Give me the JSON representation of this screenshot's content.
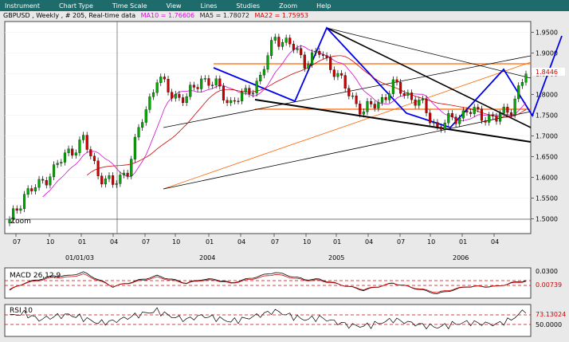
{
  "menu": {
    "items": [
      "Instrument",
      "Chart Type",
      "Time Scale",
      "View",
      "Lines",
      "Studies",
      "Zoom",
      "Help"
    ]
  },
  "info": {
    "symbol": "GBPUSD , Weekly , # 205, Real-time data",
    "ma10": "MA10 = 1.76606",
    "ma5": "MA5 = 1.78072",
    "ma22": "MA22 = 1.75953"
  },
  "price_panel": {
    "y_ticks": [
      "1.9500",
      "1.9000",
      "1.8500",
      "1.8000",
      "1.7500",
      "1.7000",
      "1.6500",
      "1.6000",
      "1.5500",
      "1.5000"
    ],
    "current_price": "1.8446",
    "zoom_marker": "Zoom"
  },
  "time_axis": {
    "labels": [
      "07",
      "10",
      "01",
      "04",
      "07",
      "10",
      "01",
      "04",
      "07",
      "10",
      "01",
      "04",
      "07",
      "10",
      "01",
      "04"
    ],
    "years": [
      "01/01/03",
      "2004",
      "2005",
      "2006"
    ]
  },
  "macd_panel": {
    "title": "MACD 26,12,9",
    "value_top": "0.0300",
    "value_current": "0.00739"
  },
  "rsi_panel": {
    "title": "RSI 10",
    "value_top": "73.13024",
    "value_level": "50.0000"
  },
  "colors": {
    "menubar": "#1e6b6b",
    "up_candle": "#00aa00",
    "down_candle": "#cc0000",
    "ma10": "#d40fd4",
    "ma22": "#d40000",
    "trend_blue": "#0000ee",
    "channel_orange": "#ff6600"
  },
  "chart_data": {
    "type": "candlestick",
    "x": [
      "2003-06",
      "2003-07",
      "2003-08",
      "2003-09",
      "2003-10",
      "2003-11",
      "2003-12",
      "2004-01",
      "2004-02",
      "2004-03",
      "2004-04",
      "2004-05",
      "2004-06",
      "2004-07",
      "2004-08",
      "2004-09",
      "2004-10",
      "2004-11",
      "2004-12",
      "2005-01",
      "2005-02",
      "2005-03",
      "2005-04",
      "2005-05",
      "2005-06",
      "2005-07",
      "2005-08",
      "2005-09",
      "2005-10",
      "2005-11",
      "2005-12",
      "2006-01",
      "2006-02",
      "2006-03",
      "2006-04",
      "2006-05"
    ],
    "close": [
      1.49,
      1.56,
      1.58,
      1.62,
      1.66,
      1.69,
      1.61,
      1.58,
      1.62,
      1.74,
      1.84,
      1.8,
      1.79,
      1.84,
      1.82,
      1.78,
      1.8,
      1.84,
      1.94,
      1.92,
      1.88,
      1.9,
      1.86,
      1.8,
      1.76,
      1.78,
      1.82,
      1.8,
      1.77,
      1.72,
      1.74,
      1.76,
      1.75,
      1.74,
      1.77,
      1.85
    ],
    "ylim": [
      1.47,
      1.97
    ],
    "xlabel": "",
    "ylabel": "",
    "macd": [
      -0.02,
      0.0,
      0.01,
      0.02,
      0.02,
      0.03,
      0.01,
      -0.01,
      0.0,
      0.01,
      0.02,
      0.01,
      0.0,
      0.01,
      0.01,
      0.0,
      0.01,
      0.02,
      0.03,
      0.02,
      0.01,
      0.01,
      0.0,
      -0.01,
      -0.02,
      -0.01,
      0.0,
      -0.01,
      -0.02,
      -0.03,
      -0.02,
      -0.01,
      -0.01,
      -0.01,
      0.0,
      0.007
    ],
    "rsi": [
      60,
      65,
      52,
      58,
      62,
      55,
      45,
      48,
      56,
      64,
      70,
      58,
      52,
      60,
      55,
      48,
      54,
      62,
      70,
      60,
      52,
      56,
      48,
      40,
      38,
      44,
      52,
      46,
      40,
      36,
      42,
      46,
      44,
      42,
      52,
      73
    ]
  }
}
